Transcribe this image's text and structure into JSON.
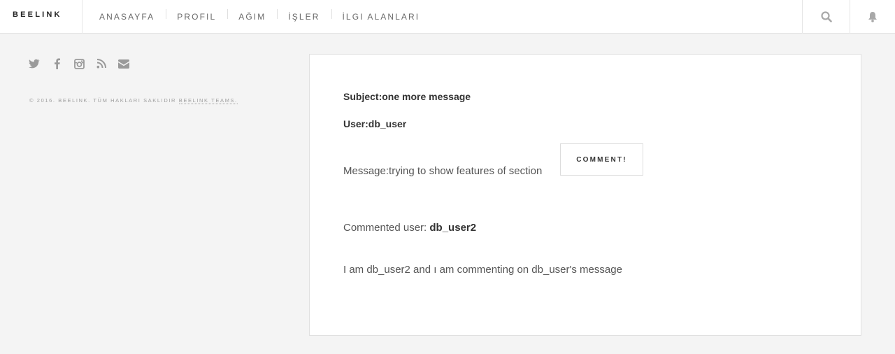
{
  "header": {
    "logo": "BEELINK",
    "nav": [
      {
        "label": "ANASAYFA"
      },
      {
        "label": "PROFIL"
      },
      {
        "label": "AĞIM"
      },
      {
        "label": "İŞLER"
      },
      {
        "label": "İLGI ALANLARI"
      }
    ],
    "icons": {
      "search": "search-icon",
      "notifications": "bell-icon"
    }
  },
  "sidebar": {
    "social_icons": [
      "twitter-icon",
      "facebook-icon",
      "instagram-icon",
      "rss-icon",
      "envelope-icon"
    ],
    "copyright_text": "© 2016. BEELINK. TÜM HAKLARI SAKLIDIR ",
    "copyright_link": "BEELINK TEAMS."
  },
  "message": {
    "subject_label": "Subject:",
    "subject": "one more message",
    "user_label": "User:",
    "user": "db_user",
    "message_label": "Message:",
    "message": "trying to show features of section",
    "comment_button": "COMMENT!"
  },
  "comment": {
    "commented_user_label": "Commented user: ",
    "commented_user": "db_user2",
    "text": "I am db_user2 and ı am commenting on db_user's message"
  },
  "colors": {
    "background": "#f4f4f4",
    "card": "#ffffff",
    "text": "#555555",
    "icon": "#9a9a9a"
  }
}
